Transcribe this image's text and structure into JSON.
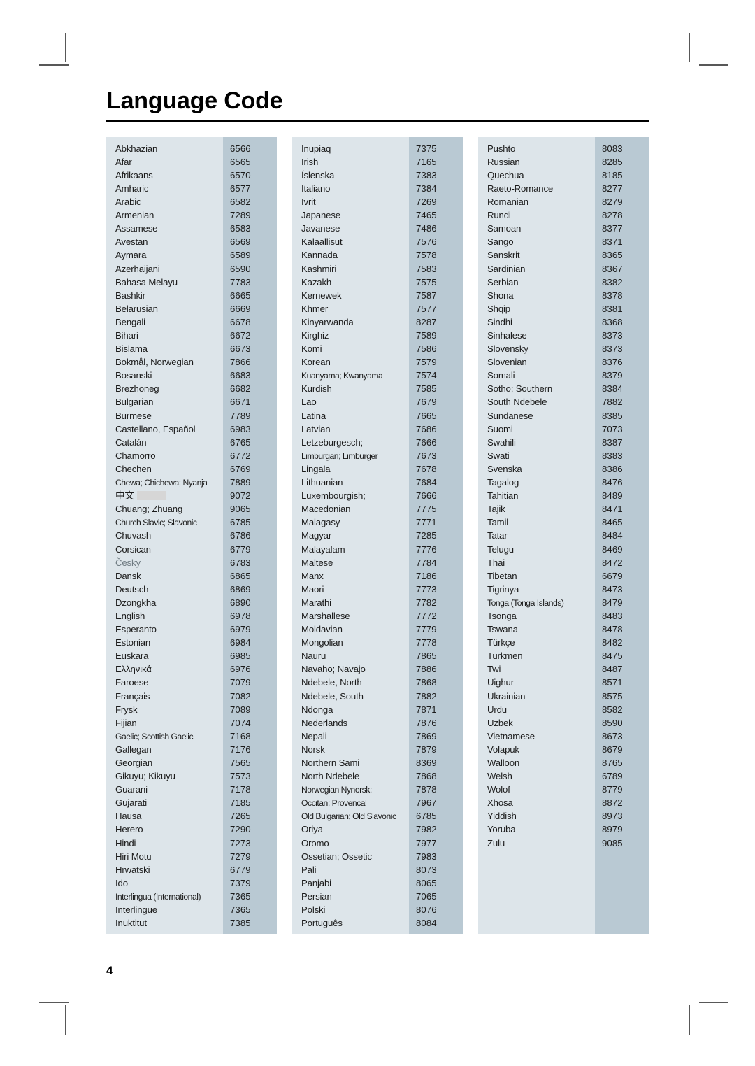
{
  "page": {
    "title": "Language Code",
    "page_number": "4"
  },
  "colors": {
    "name_cell_bg": "#dde5ea",
    "code_cell_bg": "#b9c9d3",
    "text": "#1b1b1b",
    "faint_text": "#6f7b82",
    "rule": "#000000",
    "redaction": "#d6d6d6"
  },
  "columns": [
    {
      "id": "column-1",
      "rows": [
        {
          "name": "Abkhazian",
          "code": "6566"
        },
        {
          "name": "Afar",
          "code": "6565"
        },
        {
          "name": "Afrikaans",
          "code": "6570"
        },
        {
          "name": "Amharic",
          "code": "6577"
        },
        {
          "name": "Arabic",
          "code": "6582"
        },
        {
          "name": "Armenian",
          "code": "7289"
        },
        {
          "name": "Assamese",
          "code": "6583"
        },
        {
          "name": "Avestan",
          "code": "6569"
        },
        {
          "name": "Aymara",
          "code": "6589"
        },
        {
          "name": "Azerhaijani",
          "code": "6590"
        },
        {
          "name": "Bahasa Melayu",
          "code": "7783"
        },
        {
          "name": "Bashkir",
          "code": "6665"
        },
        {
          "name": "Belarusian",
          "code": "6669"
        },
        {
          "name": "Bengali",
          "code": "6678"
        },
        {
          "name": "Bihari",
          "code": "6672"
        },
        {
          "name": "Bislama",
          "code": "6673"
        },
        {
          "name": "Bokmål, Norwegian",
          "code": "7866"
        },
        {
          "name": "Bosanski",
          "code": "6683"
        },
        {
          "name": "Brezhoneg",
          "code": "6682"
        },
        {
          "name": "Bulgarian",
          "code": "6671"
        },
        {
          "name": "Burmese",
          "code": "7789"
        },
        {
          "name": "Castellano, Español",
          "code": "6983"
        },
        {
          "name": "Catalán",
          "code": "6765"
        },
        {
          "name": "Chamorro",
          "code": "6772"
        },
        {
          "name": "Chechen",
          "code": "6769"
        },
        {
          "name": "Chewa; Chichewa; Nyanja",
          "code": "7889",
          "tight": true
        },
        {
          "name": "中文",
          "code": "9072",
          "cjk": true,
          "redacted": true
        },
        {
          "name": "Chuang; Zhuang",
          "code": "9065"
        },
        {
          "name": "Church Slavic; Slavonic",
          "code": "6785",
          "tight": true
        },
        {
          "name": "Chuvash",
          "code": "6786"
        },
        {
          "name": "Corsican",
          "code": "6779"
        },
        {
          "name": "Česky",
          "code": "6783",
          "faint": true
        },
        {
          "name": "Dansk",
          "code": "6865"
        },
        {
          "name": "Deutsch",
          "code": "6869"
        },
        {
          "name": "Dzongkha",
          "code": "6890"
        },
        {
          "name": "English",
          "code": "6978"
        },
        {
          "name": "Esperanto",
          "code": "6979"
        },
        {
          "name": "Estonian",
          "code": "6984"
        },
        {
          "name": "Euskara",
          "code": "6985"
        },
        {
          "name": "Ελληνικά",
          "code": "6976"
        },
        {
          "name": "Faroese",
          "code": "7079"
        },
        {
          "name": "Français",
          "code": "7082"
        },
        {
          "name": "Frysk",
          "code": "7089"
        },
        {
          "name": "Fijian",
          "code": "7074"
        },
        {
          "name": "Gaelic; Scottish Gaelic",
          "code": "7168",
          "tight": true
        },
        {
          "name": "Gallegan",
          "code": "7176"
        },
        {
          "name": "Georgian",
          "code": "7565"
        },
        {
          "name": "Gikuyu; Kikuyu",
          "code": "7573"
        },
        {
          "name": "Guarani",
          "code": "7178"
        },
        {
          "name": "Gujarati",
          "code": "7185"
        },
        {
          "name": "Hausa",
          "code": "7265"
        },
        {
          "name": "Herero",
          "code": "7290"
        },
        {
          "name": "Hindi",
          "code": "7273"
        },
        {
          "name": "Hiri Motu",
          "code": "7279"
        },
        {
          "name": "Hrwatski",
          "code": "6779"
        },
        {
          "name": "Ido",
          "code": "7379"
        },
        {
          "name": "Interlingua (International)",
          "code": "7365",
          "tight": true
        },
        {
          "name": "Interlingue",
          "code": "7365"
        },
        {
          "name": "Inuktitut",
          "code": "7385"
        }
      ]
    },
    {
      "id": "column-2",
      "rows": [
        {
          "name": "Inupiaq",
          "code": "7375"
        },
        {
          "name": "Irish",
          "code": "7165"
        },
        {
          "name": "Íslenska",
          "code": "7383"
        },
        {
          "name": "Italiano",
          "code": "7384"
        },
        {
          "name": "Ivrit",
          "code": "7269"
        },
        {
          "name": "Japanese",
          "code": "7465"
        },
        {
          "name": "Javanese",
          "code": "7486"
        },
        {
          "name": "Kalaallisut",
          "code": "7576"
        },
        {
          "name": "Kannada",
          "code": "7578"
        },
        {
          "name": "Kashmiri",
          "code": "7583"
        },
        {
          "name": "Kazakh",
          "code": "7575"
        },
        {
          "name": "Kernewek",
          "code": "7587"
        },
        {
          "name": "Khmer",
          "code": "7577"
        },
        {
          "name": "Kinyarwanda",
          "code": "8287"
        },
        {
          "name": "Kirghiz",
          "code": "7589"
        },
        {
          "name": "Komi",
          "code": "7586"
        },
        {
          "name": "Korean",
          "code": "7579"
        },
        {
          "name": "Kuanyama; Kwanyama",
          "code": "7574",
          "tight": true
        },
        {
          "name": "Kurdish",
          "code": "7585"
        },
        {
          "name": "Lao",
          "code": "7679"
        },
        {
          "name": "Latina",
          "code": "7665"
        },
        {
          "name": "Latvian",
          "code": "7686"
        },
        {
          "name": "Letzeburgesch;",
          "code": "7666"
        },
        {
          "name": "Limburgan; Limburger",
          "code": "7673",
          "tight": true
        },
        {
          "name": "Lingala",
          "code": "7678"
        },
        {
          "name": "Lithuanian",
          "code": "7684"
        },
        {
          "name": "Luxembourgish;",
          "code": "7666"
        },
        {
          "name": "Macedonian",
          "code": "7775"
        },
        {
          "name": "Malagasy",
          "code": "7771"
        },
        {
          "name": "Magyar",
          "code": "7285"
        },
        {
          "name": "Malayalam",
          "code": "7776"
        },
        {
          "name": "Maltese",
          "code": "7784"
        },
        {
          "name": "Manx",
          "code": "7186"
        },
        {
          "name": "Maori",
          "code": "7773"
        },
        {
          "name": "Marathi",
          "code": "7782"
        },
        {
          "name": "Marshallese",
          "code": "7772"
        },
        {
          "name": "Moldavian",
          "code": "7779"
        },
        {
          "name": "Mongolian",
          "code": "7778"
        },
        {
          "name": "Nauru",
          "code": "7865"
        },
        {
          "name": "Navaho; Navajo",
          "code": "7886"
        },
        {
          "name": "Ndebele, North",
          "code": "7868"
        },
        {
          "name": "Ndebele, South",
          "code": "7882"
        },
        {
          "name": "Ndonga",
          "code": "7871"
        },
        {
          "name": "Nederlands",
          "code": "7876"
        },
        {
          "name": "Nepali",
          "code": "7869"
        },
        {
          "name": "Norsk",
          "code": "7879"
        },
        {
          "name": "Northern Sami",
          "code": "8369"
        },
        {
          "name": "North Ndebele",
          "code": "7868"
        },
        {
          "name": "Norwegian Nynorsk;",
          "code": "7878",
          "tight": true
        },
        {
          "name": "Occitan; Provencal",
          "code": "7967",
          "tight": true
        },
        {
          "name": "Old Bulgarian; Old Slavonic",
          "code": "6785",
          "tight": true
        },
        {
          "name": "Oriya",
          "code": "7982"
        },
        {
          "name": "Oromo",
          "code": "7977"
        },
        {
          "name": "Ossetian; Ossetic",
          "code": "7983"
        },
        {
          "name": "Pali",
          "code": "8073"
        },
        {
          "name": "Panjabi",
          "code": "8065"
        },
        {
          "name": "Persian",
          "code": "7065"
        },
        {
          "name": "Polski",
          "code": "8076"
        },
        {
          "name": "Português",
          "code": "8084"
        }
      ]
    },
    {
      "id": "column-3",
      "rows": [
        {
          "name": "Pushto",
          "code": "8083"
        },
        {
          "name": "Russian",
          "code": "8285"
        },
        {
          "name": "Quechua",
          "code": "8185"
        },
        {
          "name": "Raeto-Romance",
          "code": "8277"
        },
        {
          "name": "Romanian",
          "code": "8279"
        },
        {
          "name": "Rundi",
          "code": "8278"
        },
        {
          "name": "Samoan",
          "code": "8377"
        },
        {
          "name": "Sango",
          "code": "8371"
        },
        {
          "name": "Sanskrit",
          "code": "8365"
        },
        {
          "name": "Sardinian",
          "code": "8367"
        },
        {
          "name": "Serbian",
          "code": "8382"
        },
        {
          "name": "Shona",
          "code": "8378"
        },
        {
          "name": "Shqip",
          "code": "8381"
        },
        {
          "name": "Sindhi",
          "code": "8368"
        },
        {
          "name": "Sinhalese",
          "code": "8373"
        },
        {
          "name": "Slovensky",
          "code": "8373"
        },
        {
          "name": "Slovenian",
          "code": "8376"
        },
        {
          "name": "Somali",
          "code": "8379"
        },
        {
          "name": "Sotho; Southern",
          "code": "8384"
        },
        {
          "name": "South Ndebele",
          "code": "7882"
        },
        {
          "name": "Sundanese",
          "code": "8385"
        },
        {
          "name": "Suomi",
          "code": "7073"
        },
        {
          "name": "Swahili",
          "code": "8387"
        },
        {
          "name": "Swati",
          "code": "8383"
        },
        {
          "name": "Svenska",
          "code": "8386"
        },
        {
          "name": "Tagalog",
          "code": "8476"
        },
        {
          "name": "Tahitian",
          "code": "8489"
        },
        {
          "name": "Tajik",
          "code": "8471"
        },
        {
          "name": "Tamil",
          "code": "8465"
        },
        {
          "name": "Tatar",
          "code": "8484"
        },
        {
          "name": "Telugu",
          "code": "8469"
        },
        {
          "name": "Thai",
          "code": "8472"
        },
        {
          "name": "Tibetan",
          "code": "6679"
        },
        {
          "name": "Tigrinya",
          "code": "8473"
        },
        {
          "name": "Tonga (Tonga Islands)",
          "code": "8479",
          "tight": true
        },
        {
          "name": "Tsonga",
          "code": "8483"
        },
        {
          "name": "Tswana",
          "code": "8478"
        },
        {
          "name": "Türkçe",
          "code": "8482"
        },
        {
          "name": "Turkmen",
          "code": "8475"
        },
        {
          "name": "Twi",
          "code": "8487"
        },
        {
          "name": "Uighur",
          "code": "8571"
        },
        {
          "name": "Ukrainian",
          "code": "8575"
        },
        {
          "name": "Urdu",
          "code": "8582"
        },
        {
          "name": "Uzbek",
          "code": "8590"
        },
        {
          "name": "Vietnamese",
          "code": "8673"
        },
        {
          "name": "Volapuk",
          "code": "8679"
        },
        {
          "name": "Walloon",
          "code": "8765"
        },
        {
          "name": "Welsh",
          "code": "6789"
        },
        {
          "name": "Wolof",
          "code": "8779"
        },
        {
          "name": "Xhosa",
          "code": "8872"
        },
        {
          "name": "Yiddish",
          "code": "8973"
        },
        {
          "name": "Yoruba",
          "code": "8979"
        },
        {
          "name": "Zulu",
          "code": "9085"
        },
        {
          "name": "",
          "code": ""
        },
        {
          "name": "",
          "code": ""
        },
        {
          "name": "",
          "code": ""
        },
        {
          "name": "",
          "code": ""
        },
        {
          "name": "",
          "code": ""
        },
        {
          "name": "",
          "code": ""
        }
      ]
    }
  ]
}
